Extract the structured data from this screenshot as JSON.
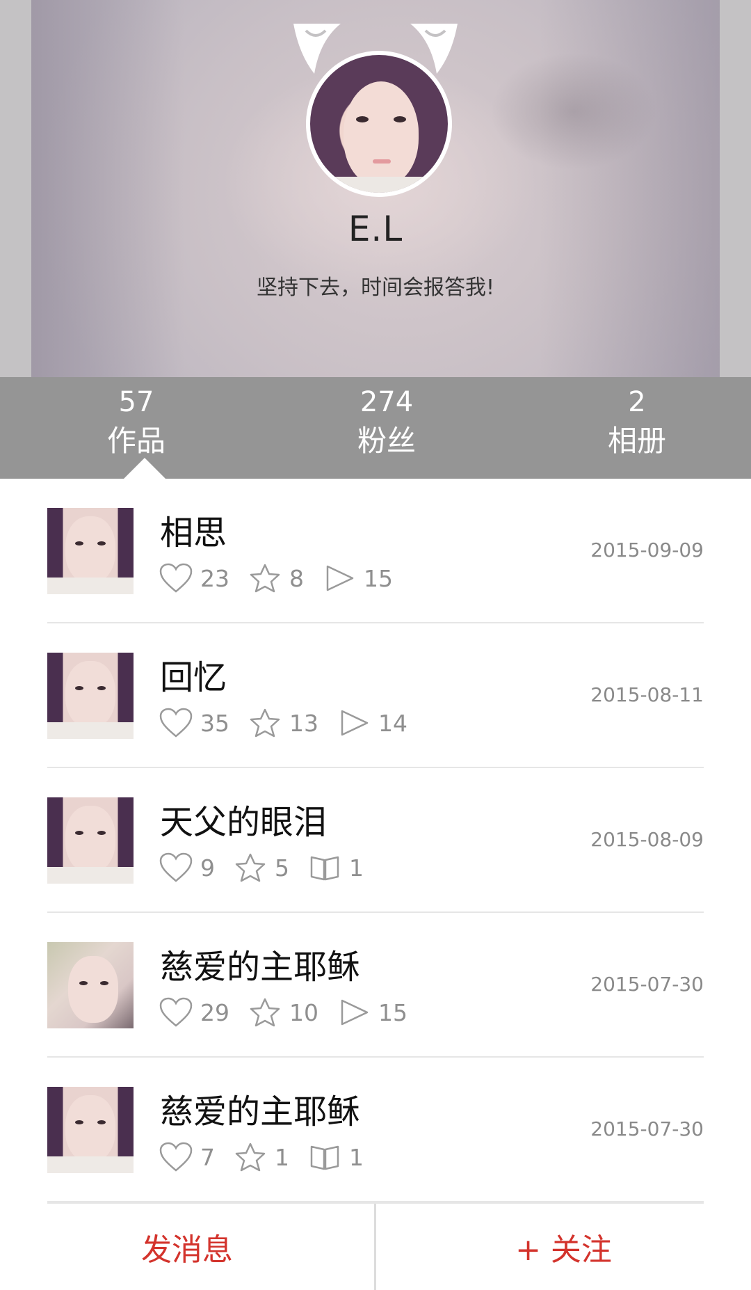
{
  "profile": {
    "name": "E.L",
    "motto": "坚持下去，时间会报答我!"
  },
  "stats": [
    {
      "count": "57",
      "label": "作品"
    },
    {
      "count": "274",
      "label": "粉丝"
    },
    {
      "count": "2",
      "label": "相册"
    }
  ],
  "works": [
    {
      "title": "相思",
      "likes": "23",
      "favorites": "8",
      "third_icon": "play-icon",
      "third_count": "15",
      "date": "2015-09-09"
    },
    {
      "title": "回忆",
      "likes": "35",
      "favorites": "13",
      "third_icon": "play-icon",
      "third_count": "14",
      "date": "2015-08-11"
    },
    {
      "title": "天父的眼泪",
      "likes": "9",
      "favorites": "5",
      "third_icon": "book-icon",
      "third_count": "1",
      "date": "2015-08-09"
    },
    {
      "title": "慈爱的主耶稣",
      "likes": "29",
      "favorites": "10",
      "third_icon": "play-icon",
      "third_count": "15",
      "date": "2015-07-30"
    },
    {
      "title": "慈爱的主耶稣",
      "likes": "7",
      "favorites": "1",
      "third_icon": "book-icon",
      "third_count": "1",
      "date": "2015-07-30"
    }
  ],
  "actions": {
    "message": "发消息",
    "follow": "+ 关注"
  },
  "colors": {
    "stats_bar": "#959595",
    "action_text": "#d3332c",
    "meta_text": "#8f8f8f"
  }
}
